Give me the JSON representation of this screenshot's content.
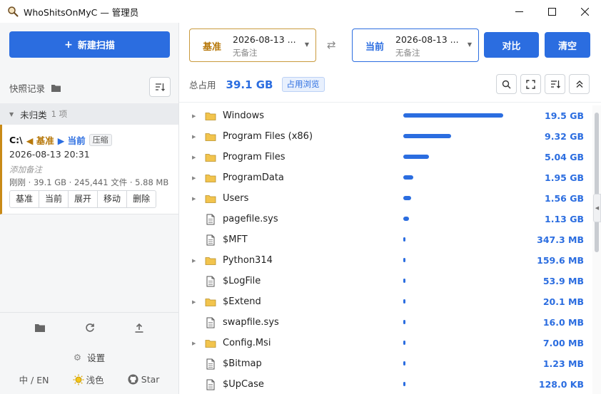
{
  "window": {
    "title": "WhoShitsOnMyC — 管理员",
    "icon": "magnifier-app-icon"
  },
  "sidebar": {
    "new_scan_label": "新建扫描",
    "snapshots_title": "快照记录",
    "group": {
      "name": "未归类",
      "count": "1 项"
    },
    "snapshot": {
      "drive": "C:\\",
      "base_tag": "◀ 基准",
      "current_tag": "▶ 当前",
      "compress_tag": "压缩",
      "date": "2026-08-13 20:31",
      "note_placeholder": "添加备注",
      "meta": "刚刚 · 39.1 GB · 245,441 文件 · 5.88 MB",
      "actions": [
        "基准",
        "当前",
        "展开",
        "移动",
        "删除"
      ]
    },
    "settings_label": "设置",
    "footer": {
      "lang": "中 / EN",
      "theme": "浅色",
      "star": "Star"
    }
  },
  "compare": {
    "base": {
      "label": "基准",
      "date": "2026-08-13 ...",
      "note": "无备注"
    },
    "current": {
      "label": "当前",
      "date": "2026-08-13 ...",
      "note": "无备注"
    },
    "compare_button": "对比",
    "clear_button": "清空"
  },
  "stats": {
    "total_label": "总占用",
    "total_value": "39.1 GB",
    "usage_button": "占用浏览"
  },
  "colors": {
    "accent": "#2b6de0",
    "base": "#b7780a",
    "folder": "#f2c44d"
  },
  "tree": [
    {
      "name": "Windows",
      "type": "folder",
      "expandable": true,
      "size": "19.5 GB",
      "fraction": 1.0
    },
    {
      "name": "Program Files (x86)",
      "type": "folder",
      "expandable": true,
      "size": "9.32 GB",
      "fraction": 0.478
    },
    {
      "name": "Program Files",
      "type": "folder",
      "expandable": true,
      "size": "5.04 GB",
      "fraction": 0.258
    },
    {
      "name": "ProgramData",
      "type": "folder",
      "expandable": true,
      "size": "1.95 GB",
      "fraction": 0.1
    },
    {
      "name": "Users",
      "type": "folder",
      "expandable": true,
      "size": "1.56 GB",
      "fraction": 0.08
    },
    {
      "name": "pagefile.sys",
      "type": "file",
      "expandable": false,
      "size": "1.13 GB",
      "fraction": 0.058
    },
    {
      "name": "$MFT",
      "type": "file",
      "expandable": false,
      "size": "347.3 MB",
      "fraction": 0.017
    },
    {
      "name": "Python314",
      "type": "folder",
      "expandable": true,
      "size": "159.6 MB",
      "fraction": 0.008
    },
    {
      "name": "$LogFile",
      "type": "file",
      "expandable": false,
      "size": "53.9 MB",
      "fraction": 0.003
    },
    {
      "name": "$Extend",
      "type": "folder",
      "expandable": true,
      "size": "20.1 MB",
      "fraction": 0.001
    },
    {
      "name": "swapfile.sys",
      "type": "file",
      "expandable": false,
      "size": "16.0 MB",
      "fraction": 0.001
    },
    {
      "name": "Config.Msi",
      "type": "folder",
      "expandable": true,
      "size": "7.00 MB",
      "fraction": 0.0004
    },
    {
      "name": "$Bitmap",
      "type": "file",
      "expandable": false,
      "size": "1.23 MB",
      "fraction": 0.0001
    },
    {
      "name": "$UpCase",
      "type": "file",
      "expandable": false,
      "size": "128.0 KB",
      "fraction": 0.0
    }
  ]
}
